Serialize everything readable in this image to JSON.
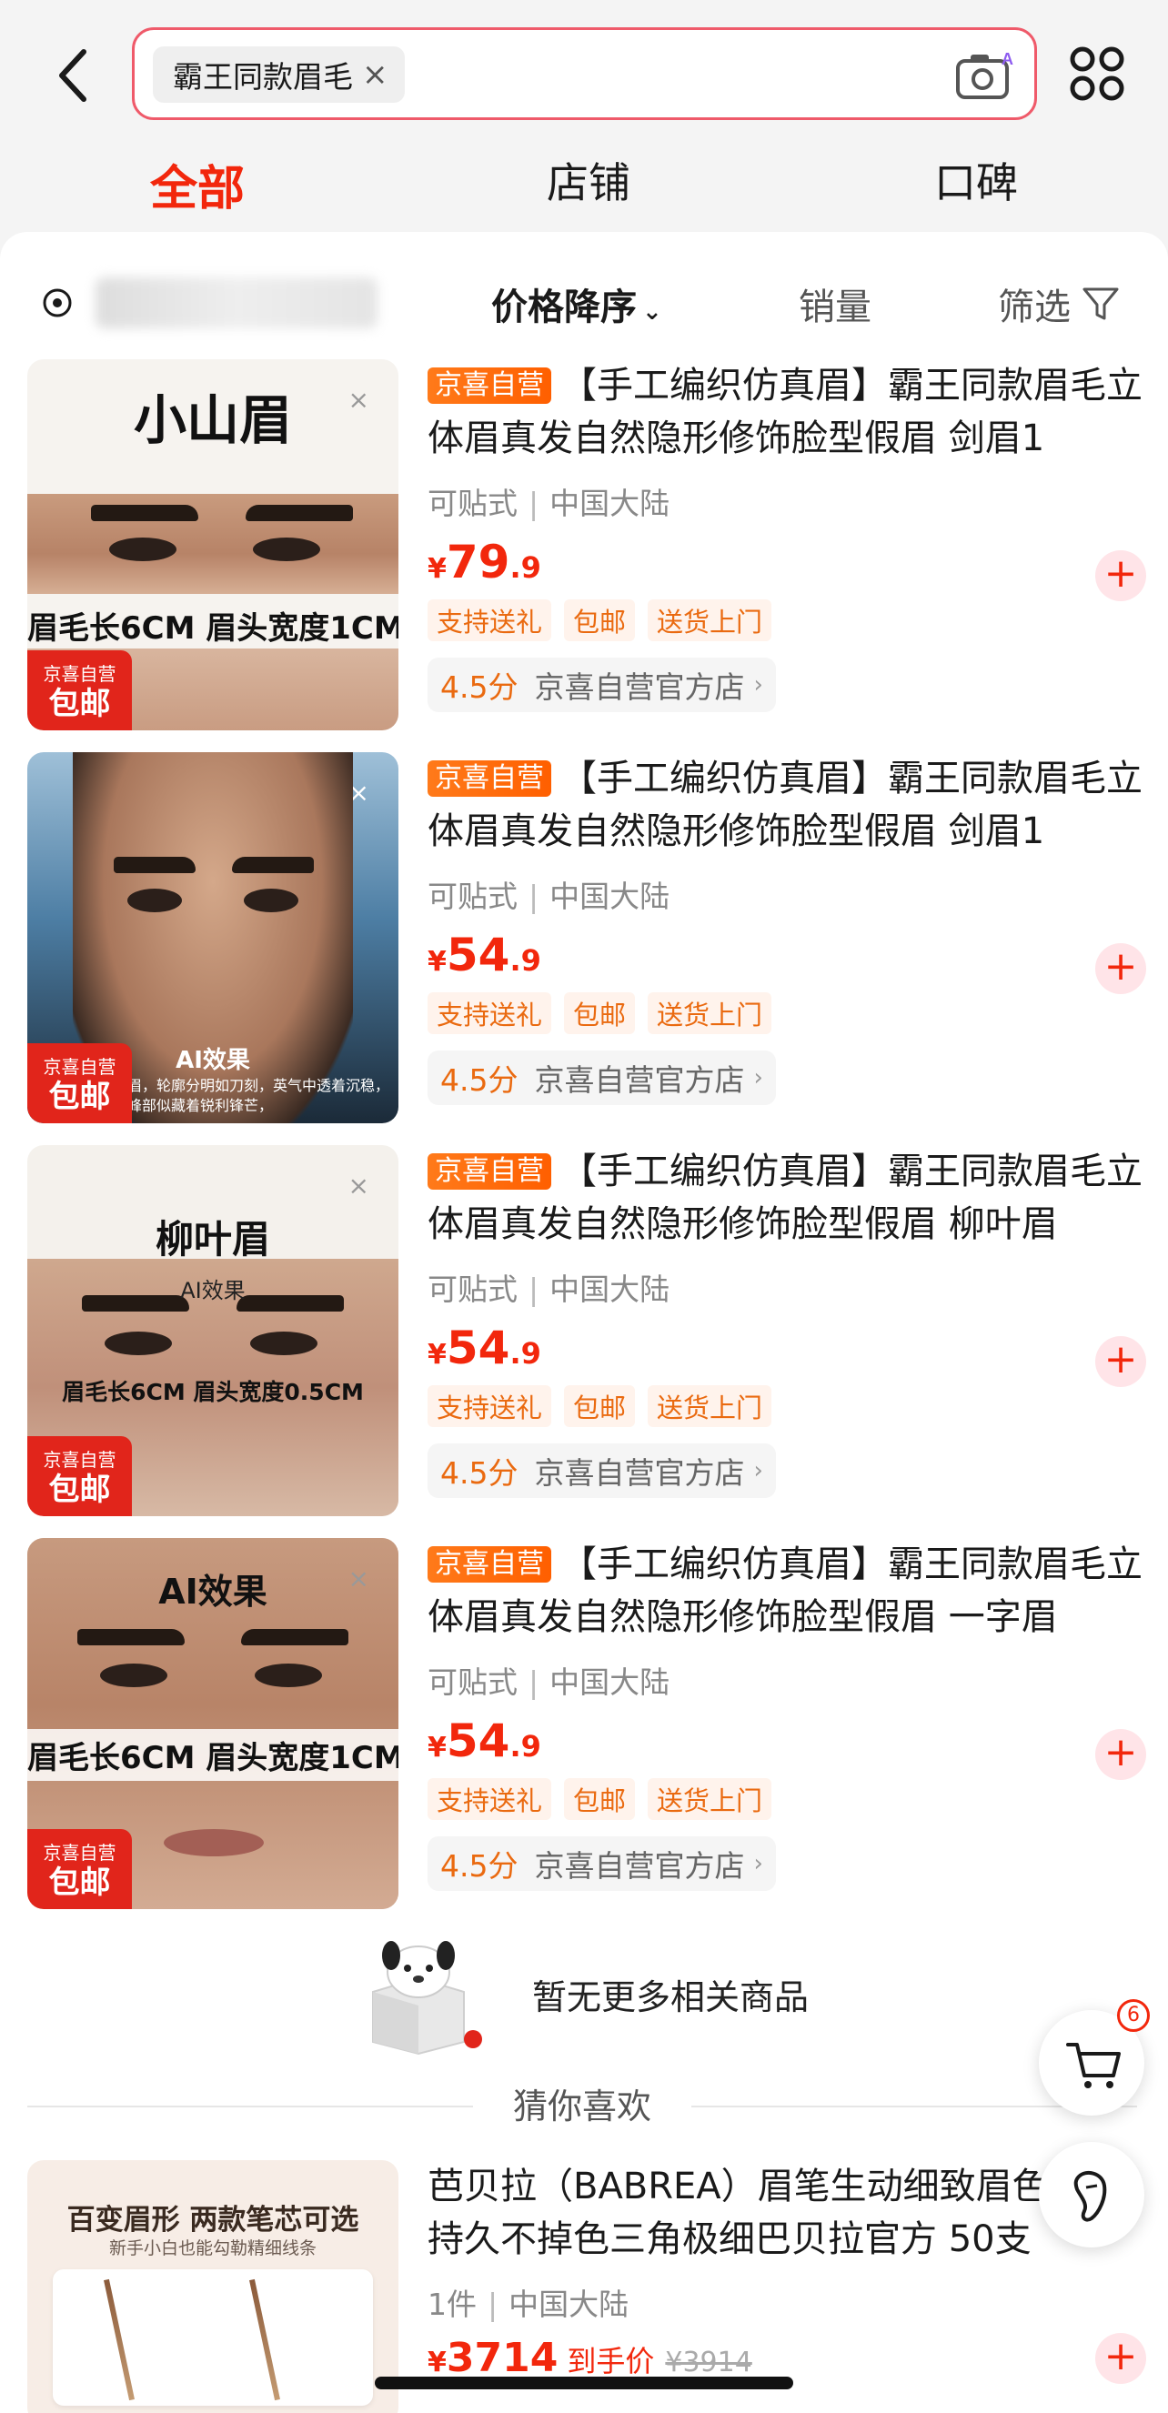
{
  "header": {
    "search_chip": "霸王同款眉毛",
    "chip_clear": "×",
    "camera_badge": "AI"
  },
  "tabs": [
    {
      "label": "全部",
      "active": true
    },
    {
      "label": "店铺",
      "active": false
    },
    {
      "label": "口碑",
      "active": false
    }
  ],
  "filter_bar": {
    "sort_price": "价格降序",
    "sort_sales": "销量",
    "filter": "筛选"
  },
  "products": [
    {
      "tag": "京喜自营",
      "title": "【手工编织仿真眉】霸王同款眉毛立体眉真发自然隐形修饰脸型假眉 剑眉1",
      "meta_a": "可贴式",
      "meta_b": "中国大陆",
      "price_int": "79",
      "price_dec": ".9",
      "chips": [
        "支持送礼",
        "包邮",
        "送货上门"
      ],
      "score": "4.5分",
      "store": "京喜自营官方店",
      "thumb_headline": "小山眉",
      "thumb_strip": "眉毛长6CM 眉头宽度1CM",
      "thumb_ai": ""
    },
    {
      "tag": "京喜自营",
      "title": "【手工编织仿真眉】霸王同款眉毛立体眉真发自然隐形修饰脸型假眉 剑眉1",
      "meta_a": "可贴式",
      "meta_b": "中国大陆",
      "price_int": "54",
      "price_dec": ".9",
      "chips": [
        "支持送礼",
        "包邮",
        "送货上门"
      ],
      "score": "4.5分",
      "store": "京喜自营官方店",
      "thumb_headline": "",
      "thumb_strip": "",
      "thumb_ai": "AI效果",
      "thumb_ai_caption": "眉，轮廓分明如刀刻，英气中透着沉稳，峰部似藏着锐利锋芒，"
    },
    {
      "tag": "京喜自营",
      "title": "【手工编织仿真眉】霸王同款眉毛立体眉真发自然隐形修饰脸型假眉  柳叶眉",
      "meta_a": "可贴式",
      "meta_b": "中国大陆",
      "price_int": "54",
      "price_dec": ".9",
      "chips": [
        "支持送礼",
        "包邮",
        "送货上门"
      ],
      "score": "4.5分",
      "store": "京喜自营官方店",
      "thumb_headline": "柳叶眉",
      "thumb_strip": "眉毛长6CM 眉头宽度0.5CM",
      "thumb_ai": "AI效果"
    },
    {
      "tag": "京喜自营",
      "title": "【手工编织仿真眉】霸王同款眉毛立体眉真发自然隐形修饰脸型假眉 一字眉",
      "meta_a": "可贴式",
      "meta_b": "中国大陆",
      "price_int": "54",
      "price_dec": ".9",
      "chips": [
        "支持送礼",
        "包邮",
        "送货上门"
      ],
      "score": "4.5分",
      "store": "京喜自营官方店",
      "thumb_headline": "AI效果",
      "thumb_strip": "眉毛长6CM 眉头宽度1CM",
      "thumb_ai": ""
    }
  ],
  "thumb_badge": {
    "line1": "京喜自营",
    "line2": "包邮"
  },
  "yen": "¥",
  "store_arrow": "›",
  "add_icon": "+",
  "empty_text": "暂无更多相关商品",
  "guess_label": "猜你喜欢",
  "recommend": {
    "title": "芭贝拉（BABREA）眉笔生动细致眉色防水持久不掉色三角极细巴贝拉官方 50支",
    "meta_a": "1件",
    "meta_b": "中国大陆",
    "price": "3714",
    "price_label": "到手价",
    "orig_price": "¥3914",
    "thumb_head": "百变眉形 两款笔芯可选",
    "thumb_sub": "新手小白也能勾勒精细线条"
  },
  "cart_badge": "6",
  "colors": {
    "accent": "#f2270c",
    "tag": "#ff6a00",
    "search_border": "#ef5a6a"
  }
}
